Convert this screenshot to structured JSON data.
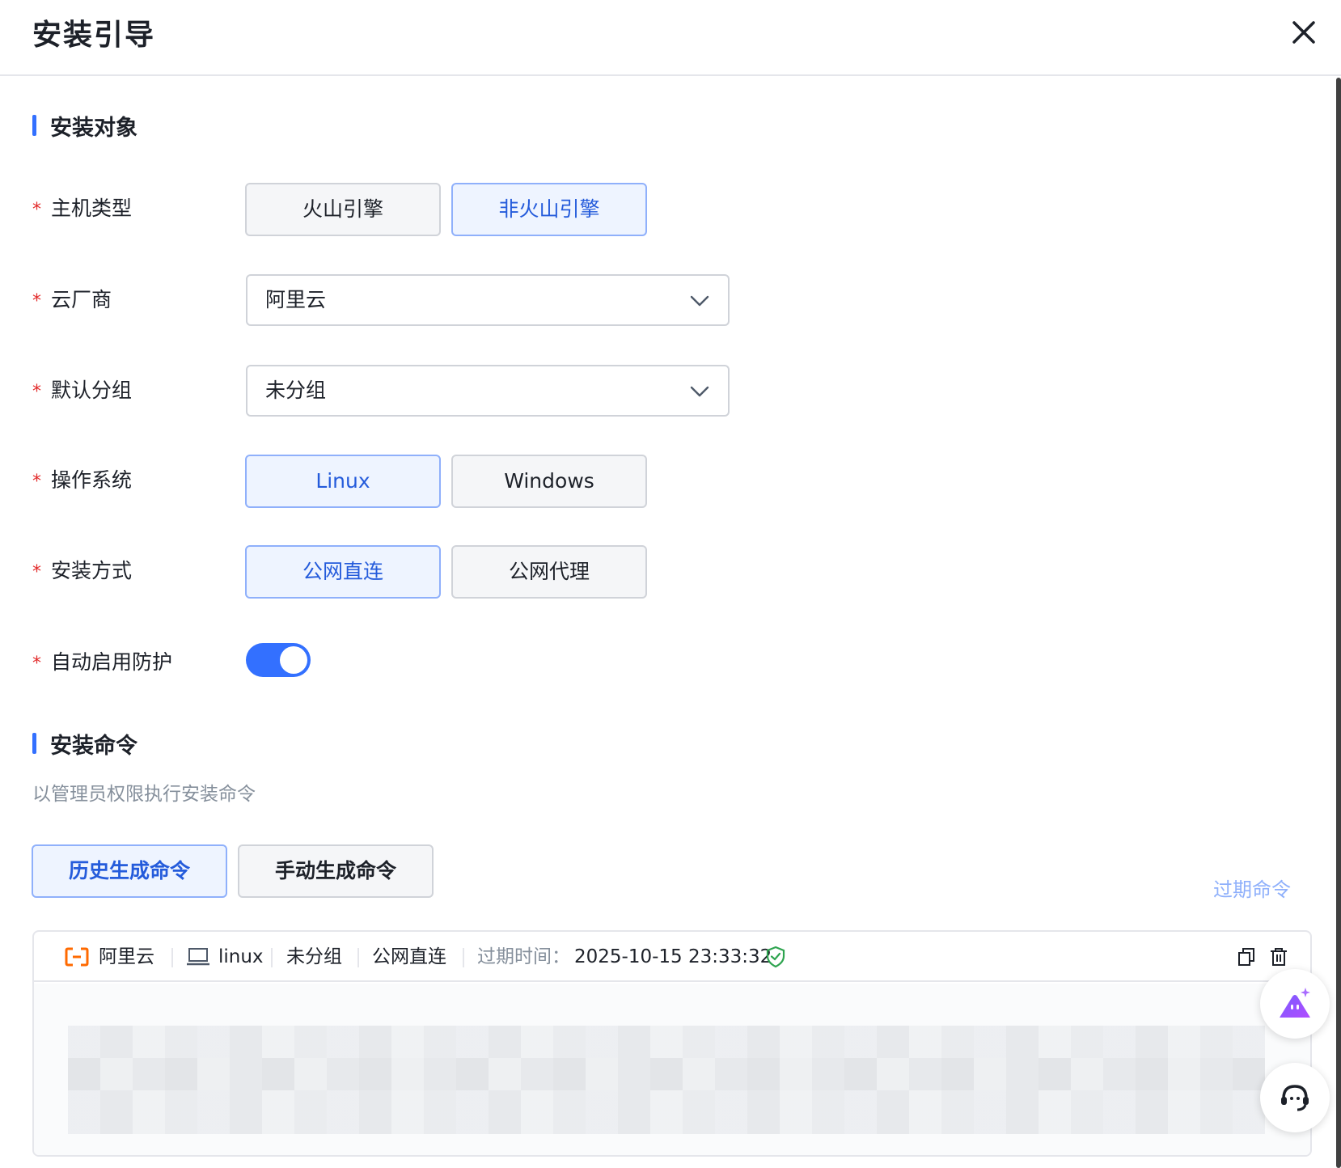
{
  "header": {
    "title": "安装引导"
  },
  "section_target": {
    "title": "安装对象"
  },
  "form": {
    "host_type": {
      "label": "主机类型",
      "options": [
        "火山引擎",
        "非火山引擎"
      ],
      "selected": "非火山引擎"
    },
    "cloud_vendor": {
      "label": "云厂商",
      "value": "阿里云"
    },
    "default_group": {
      "label": "默认分组",
      "value": "未分组"
    },
    "os": {
      "label": "操作系统",
      "options": [
        "Linux",
        "Windows"
      ],
      "selected": "Linux"
    },
    "install_method": {
      "label": "安装方式",
      "options": [
        "公网直连",
        "公网代理"
      ],
      "selected": "公网直连"
    },
    "auto_protect": {
      "label": "自动启用防护",
      "enabled": true
    }
  },
  "section_command": {
    "title": "安装命令",
    "hint": "以管理员权限执行安装命令"
  },
  "command_tabs": {
    "options": [
      "历史生成命令",
      "手动生成命令"
    ],
    "selected": "历史生成命令"
  },
  "expired_link": "过期命令",
  "command_card": {
    "vendor": "阿里云",
    "os": "linux",
    "group": "未分组",
    "method": "公网直连",
    "expire_label": "过期时间：",
    "expire_time": "2025-10-15 23:33:32"
  },
  "colors": {
    "accent": "#3370ff",
    "required": "#e22b2b",
    "vendor_orange": "#ff6a00",
    "safe_green": "#2ea44f"
  }
}
